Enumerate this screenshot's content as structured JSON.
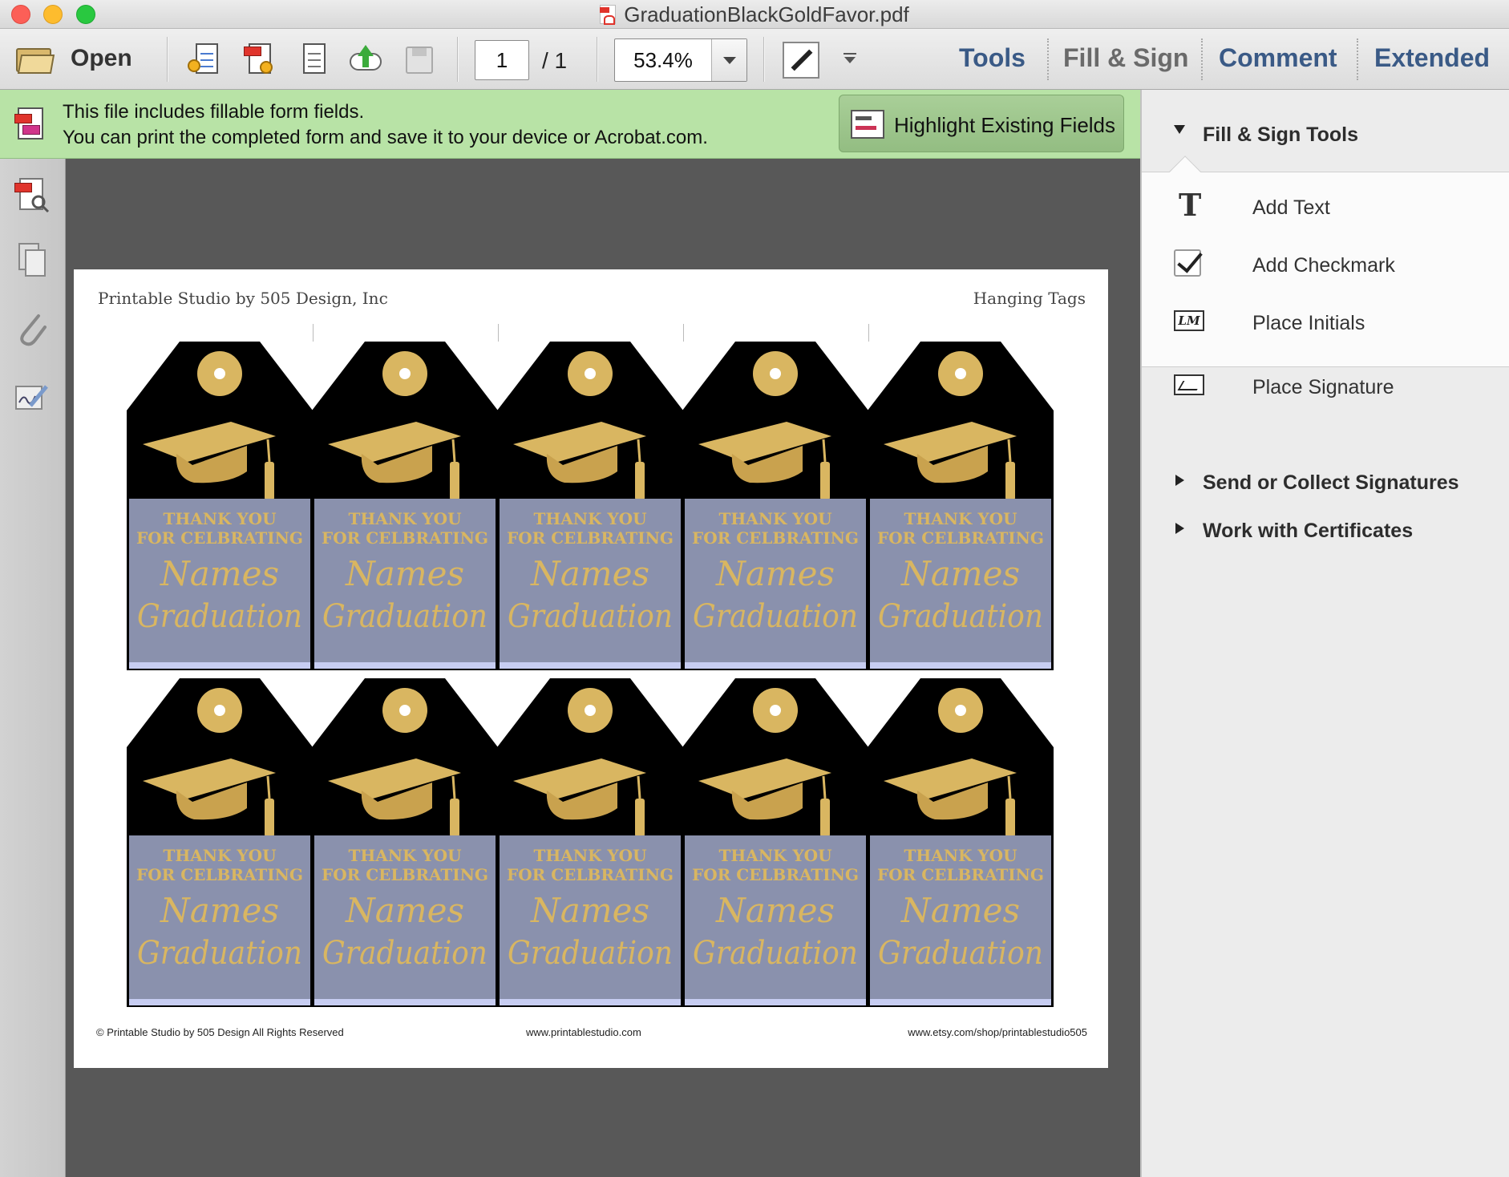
{
  "window": {
    "title": "GraduationBlackGoldFavor.pdf"
  },
  "toolbar": {
    "open_label": "Open",
    "page_current": "1",
    "page_total": "/ 1",
    "zoom": "53.4%",
    "tabs": [
      {
        "label": "Tools",
        "color": "#3a5a86"
      },
      {
        "label": "Fill & Sign",
        "color": "#6a6a6a"
      },
      {
        "label": "Comment",
        "color": "#3a5a86"
      },
      {
        "label": "Extended",
        "color": "#3a5a86"
      }
    ]
  },
  "notice": {
    "line1": "This file includes fillable form fields.",
    "line2": "You can print the completed form and save it to your device or Acrobat.com.",
    "button_label": "Highlight Existing Fields",
    "background": "#b8e3a6"
  },
  "document": {
    "header_left": "Printable Studio by 505 Design, Inc",
    "header_right": "Hanging Tags",
    "footer_left": "© Printable Studio by 505 Design All Rights Reserved",
    "footer_center": "www.printablestudio.com",
    "footer_right": "www.etsy.com/shop/printablestudio505",
    "tag": {
      "line1": "THANK YOU",
      "line2": "FOR CELBRATING",
      "script1": "Names",
      "script2": "Graduation",
      "rows": 2,
      "columns": 5,
      "colors": {
        "tag": "#000000",
        "gold": "#d9b661",
        "panel": "#8a91ad",
        "strip": "#c7cdf2"
      }
    }
  },
  "panel": {
    "fill_sign_title": "Fill & Sign Tools",
    "tools": [
      {
        "label": "Add Text",
        "icon": "text-icon"
      },
      {
        "label": "Add Checkmark",
        "icon": "checkmark-icon"
      },
      {
        "label": "Place Initials",
        "icon": "initials-icon",
        "icon_text": "LM"
      },
      {
        "label": "Place Signature",
        "icon": "signature-icon"
      }
    ],
    "send_collect": "Send or Collect Signatures",
    "certificates": "Work with Certificates"
  }
}
